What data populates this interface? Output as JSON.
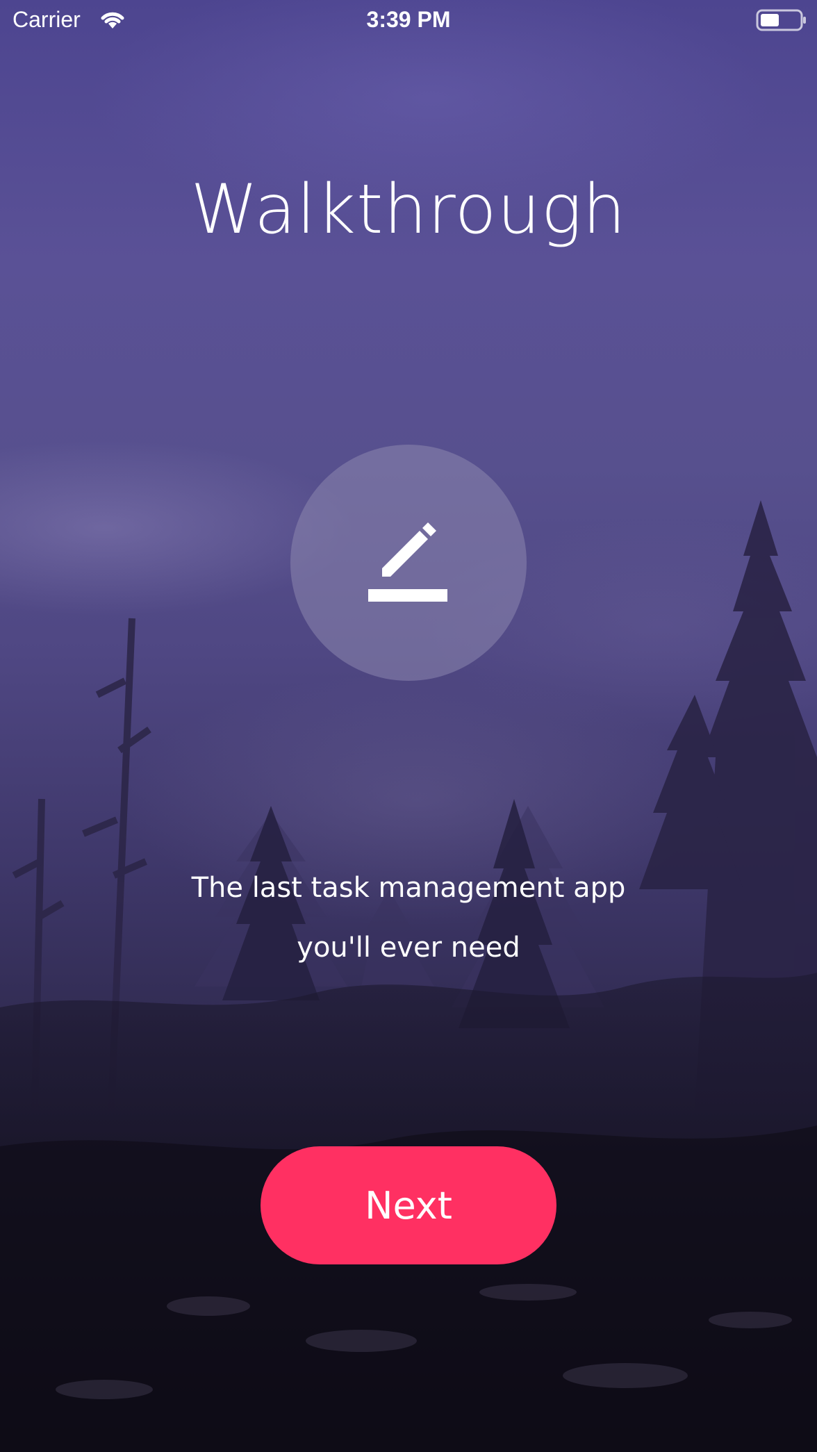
{
  "status_bar": {
    "carrier": "Carrier",
    "time": "3:39 PM",
    "wifi_icon": "wifi-icon",
    "battery_icon": "battery-icon"
  },
  "walkthrough": {
    "title": "Walkthrough",
    "icon": "edit-pencil-icon",
    "subtitle_line1": "The last task management app",
    "subtitle_line2": "you'll ever need",
    "next_label": "Next"
  },
  "colors": {
    "accent": "#ff3062",
    "background_top": "#4d4590",
    "background_bottom": "#0f0d17"
  }
}
